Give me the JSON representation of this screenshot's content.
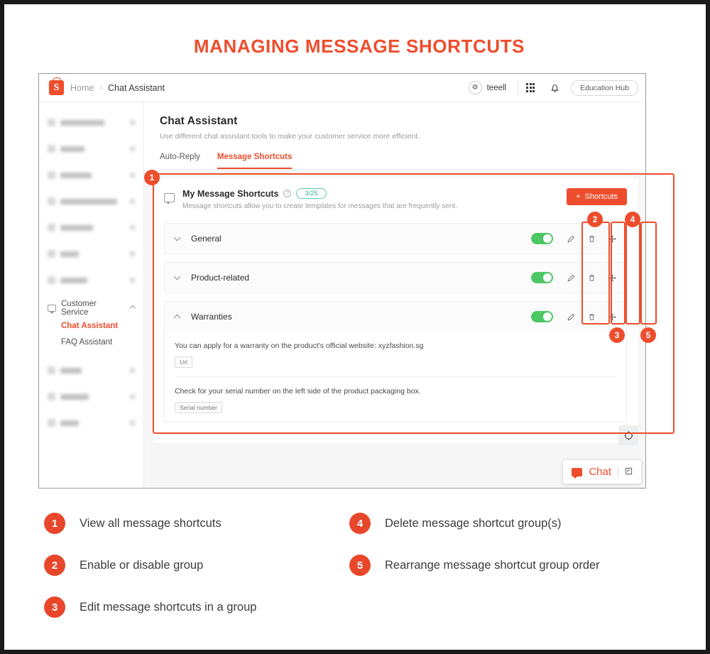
{
  "title": "MANAGING MESSAGE SHORTCUTS",
  "browser": {
    "topbar": {
      "logo_icon": "shopee-logo",
      "logo_letter": "S",
      "breadcrumb_home": "Home",
      "breadcrumb_sep": "›",
      "breadcrumb_current": "Chat Assistant",
      "username": "teeell",
      "avatar_icon": "user-avatar-icon",
      "apps_icon": "apps-grid-icon",
      "bell_icon": "notification-bell-icon",
      "education_hub_label": "Education Hub"
    },
    "sidebar": {
      "blurred_item_count": 7,
      "blurred_item_count_bottom": 3,
      "group": {
        "label": "Customer Service",
        "icon": "message-icon",
        "chevron_icon": "chevron-up-icon",
        "children": [
          {
            "label": "Chat Assistant",
            "active": true
          },
          {
            "label": "FAQ Assistant",
            "active": false
          }
        ]
      }
    },
    "main": {
      "page_title": "Chat Assistant",
      "page_subtitle": "Use different chat assistant tools to make your customer service more efficient.",
      "tabs": [
        {
          "label": "Auto-Reply",
          "active": false
        },
        {
          "label": "Message Shortcuts",
          "active": true
        }
      ],
      "panel": {
        "icon": "message-bubble-icon",
        "title": "My Message Shortcuts",
        "help_icon": "question-mark-icon",
        "count_badge": "3/25",
        "description": "Message shortcuts allow you to create templates for messages that are frequently sent.",
        "add_button": {
          "plus": "+",
          "label": "Shortcuts"
        },
        "groups": [
          {
            "name": "General",
            "expanded": false,
            "enabled": true,
            "chevron_icon": "chevron-down-icon",
            "edit_icon": "pencil-icon",
            "delete_icon": "trash-icon",
            "drag_icon": "move-arrows-icon",
            "messages": []
          },
          {
            "name": "Product-related",
            "expanded": false,
            "enabled": true,
            "chevron_icon": "chevron-down-icon",
            "edit_icon": "pencil-icon",
            "delete_icon": "trash-icon",
            "drag_icon": "move-arrows-icon",
            "messages": []
          },
          {
            "name": "Warranties",
            "expanded": true,
            "enabled": true,
            "chevron_icon": "chevron-up-icon",
            "edit_icon": "pencil-icon",
            "delete_icon": "trash-icon",
            "drag_icon": "move-arrows-icon",
            "messages": [
              {
                "text": "You can apply for a warranty on the product's official website: xyzfashion.sg",
                "tag": "Url"
              },
              {
                "text": "Check for your serial number on the left side of the product packaging box.",
                "tag": "Serial number"
              }
            ]
          }
        ]
      },
      "scroll_top_icon": "scroll-to-top-icon",
      "chat_widget": {
        "icon": "chat-bubble-icon",
        "label": "Chat",
        "expand_icon": "expand-icon"
      }
    }
  },
  "annotations": [
    {
      "number": "1"
    },
    {
      "number": "2"
    },
    {
      "number": "3"
    },
    {
      "number": "4"
    },
    {
      "number": "5"
    }
  ],
  "legend": [
    {
      "number": "1",
      "text": "View all message shortcuts"
    },
    {
      "number": "4",
      "text": "Delete message shortcut group(s)"
    },
    {
      "number": "2",
      "text": "Enable or disable group"
    },
    {
      "number": "5",
      "text": "Rearrange message shortcut group order"
    },
    {
      "number": "3",
      "text": "Edit message shortcuts in a group"
    }
  ],
  "colors": {
    "brand_orange": "#EE4D2D",
    "toggle_green": "#4CC764",
    "badge_teal": "#2FB39A",
    "frame_black": "#1A1A1A"
  }
}
